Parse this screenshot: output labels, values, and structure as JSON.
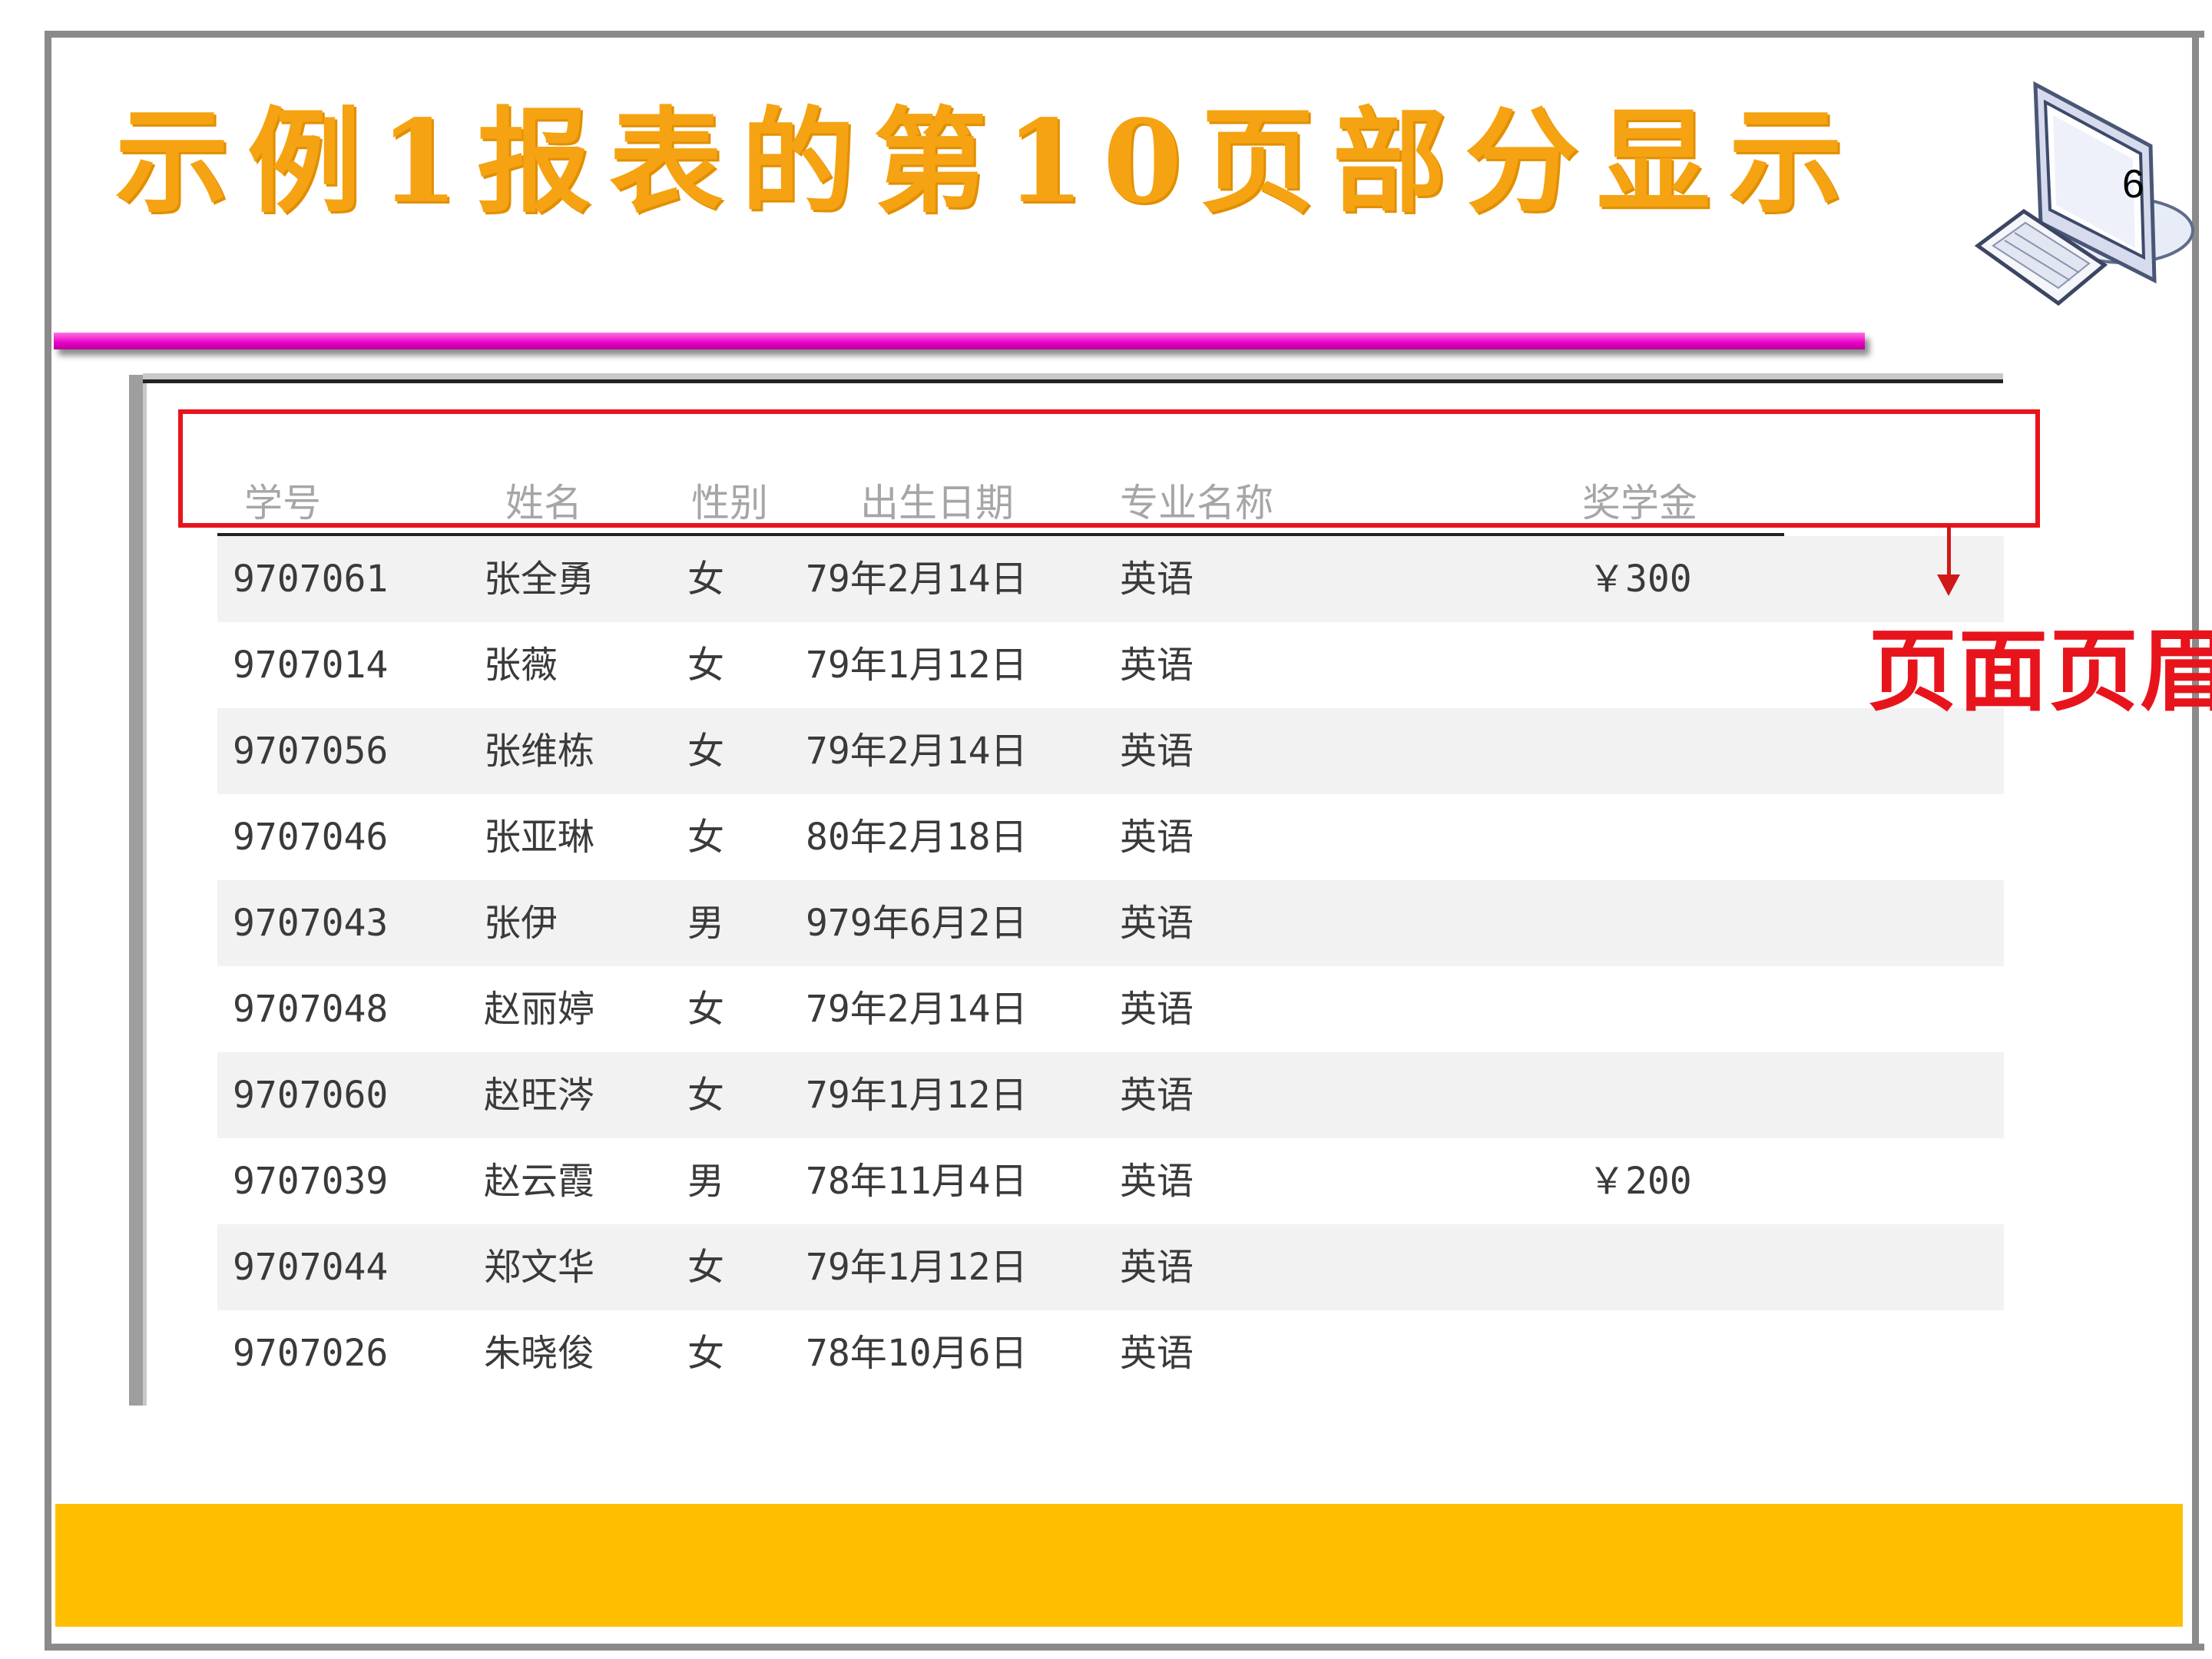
{
  "slide": {
    "title": "示例1报表的第10页部分显示",
    "page_number": "6",
    "annotation": "页面页眉"
  },
  "report": {
    "headers": [
      "学号",
      "姓名",
      "性别",
      "出生日期",
      "专业名称",
      "奖学金"
    ],
    "rows": [
      {
        "id": "9707061",
        "name": "张全勇",
        "gender": "女",
        "birth": "79年2月14日",
        "major": "英语",
        "scholarship": "￥300"
      },
      {
        "id": "9707014",
        "name": "张薇",
        "gender": "女",
        "birth": "79年1月12日",
        "major": "英语",
        "scholarship": ""
      },
      {
        "id": "9707056",
        "name": "张维栋",
        "gender": "女",
        "birth": "79年2月14日",
        "major": "英语",
        "scholarship": ""
      },
      {
        "id": "9707046",
        "name": "张亚琳",
        "gender": "女",
        "birth": "80年2月18日",
        "major": "英语",
        "scholarship": ""
      },
      {
        "id": "9707043",
        "name": "张伊",
        "gender": "男",
        "birth": "979年6月2日",
        "major": "英语",
        "scholarship": ""
      },
      {
        "id": "9707048",
        "name": "赵丽婷",
        "gender": "女",
        "birth": "79年2月14日",
        "major": "英语",
        "scholarship": ""
      },
      {
        "id": "9707060",
        "name": "赵旺涔",
        "gender": "女",
        "birth": "79年1月12日",
        "major": "英语",
        "scholarship": ""
      },
      {
        "id": "9707039",
        "name": "赵云霞",
        "gender": "男",
        "birth": "78年11月4日",
        "major": "英语",
        "scholarship": "￥200"
      },
      {
        "id": "9707044",
        "name": "郑文华",
        "gender": "女",
        "birth": "79年1月12日",
        "major": "英语",
        "scholarship": ""
      },
      {
        "id": "9707026",
        "name": "朱晓俊",
        "gender": "女",
        "birth": "78年10月6日",
        "major": "英语",
        "scholarship": ""
      }
    ]
  },
  "colors": {
    "title": "#f5a313",
    "pink_bar": "#e800c7",
    "annotation": "#e8141c",
    "footer_bar": "#ffbf00"
  },
  "icons": [
    "computer-icon"
  ]
}
